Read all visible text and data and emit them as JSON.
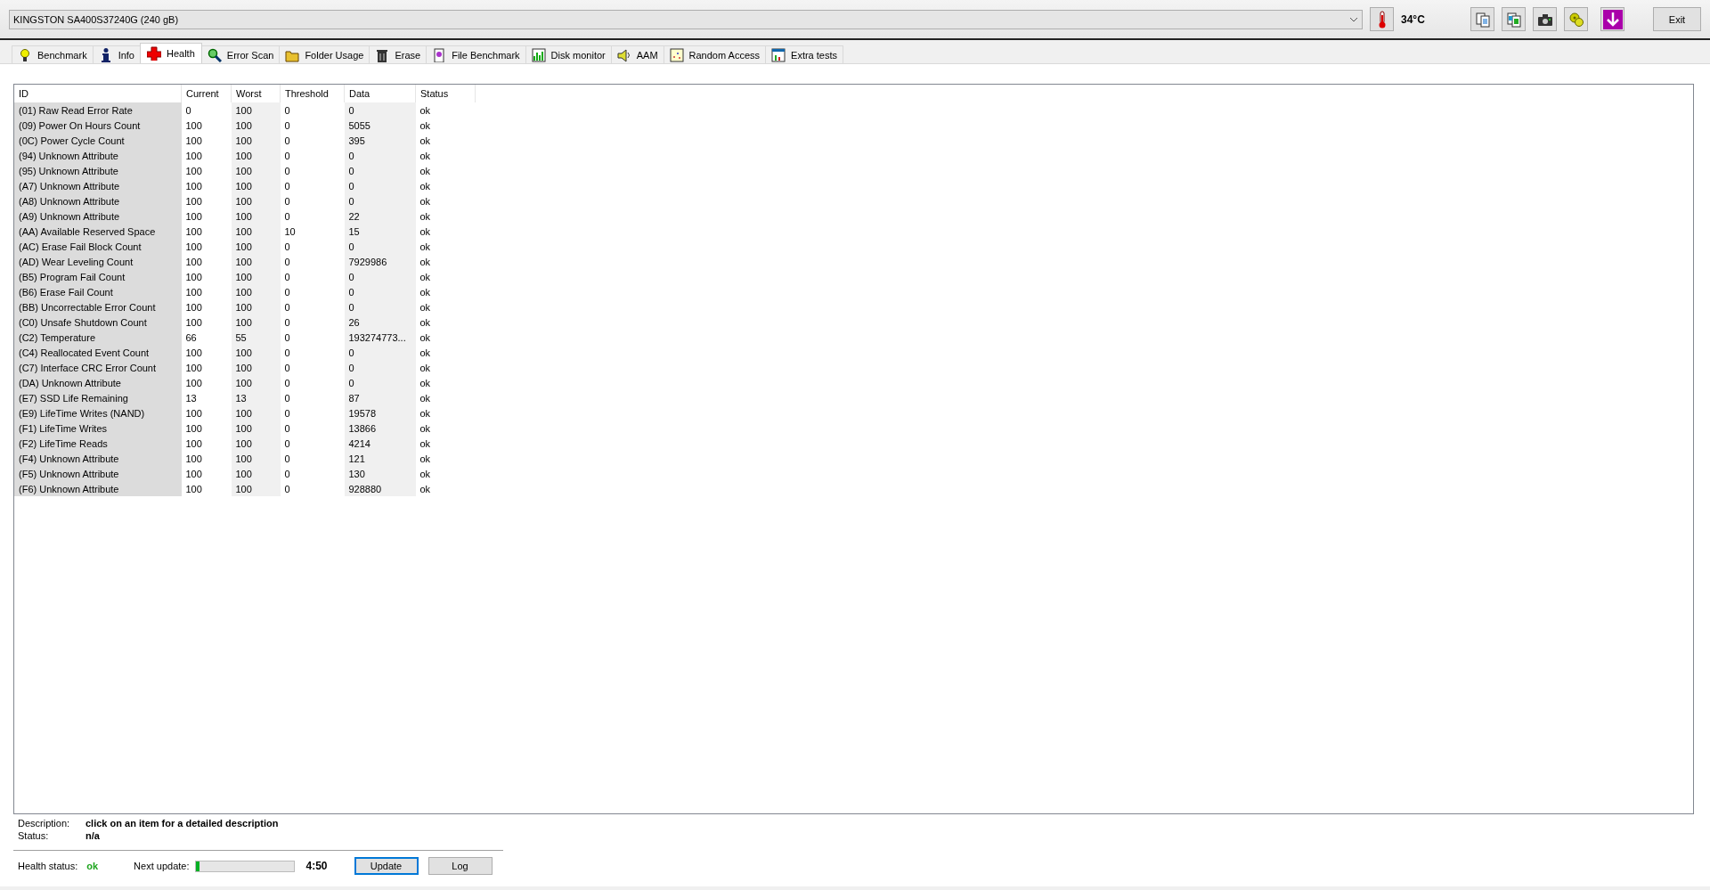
{
  "toolbar": {
    "drive": "KINGSTON SA400S37240G (240 gB)",
    "temperature": "34°C",
    "exit_button": "Exit"
  },
  "tabs": [
    {
      "label": "Benchmark",
      "selected": false
    },
    {
      "label": "Info",
      "selected": false
    },
    {
      "label": "Health",
      "selected": true
    },
    {
      "label": "Error Scan",
      "selected": false
    },
    {
      "label": "Folder Usage",
      "selected": false
    },
    {
      "label": "Erase",
      "selected": false
    },
    {
      "label": "File Benchmark",
      "selected": false
    },
    {
      "label": "Disk monitor",
      "selected": false
    },
    {
      "label": "AAM",
      "selected": false
    },
    {
      "label": "Random Access",
      "selected": false
    },
    {
      "label": "Extra tests",
      "selected": false
    }
  ],
  "table": {
    "columns": [
      "ID",
      "Current",
      "Worst",
      "Threshold",
      "Data",
      "Status"
    ],
    "rows": [
      [
        "(01) Raw Read Error Rate",
        "0",
        "100",
        "0",
        "0",
        "ok"
      ],
      [
        "(09) Power On Hours Count",
        "100",
        "100",
        "0",
        "5055",
        "ok"
      ],
      [
        "(0C) Power Cycle Count",
        "100",
        "100",
        "0",
        "395",
        "ok"
      ],
      [
        "(94) Unknown Attribute",
        "100",
        "100",
        "0",
        "0",
        "ok"
      ],
      [
        "(95) Unknown Attribute",
        "100",
        "100",
        "0",
        "0",
        "ok"
      ],
      [
        "(A7) Unknown Attribute",
        "100",
        "100",
        "0",
        "0",
        "ok"
      ],
      [
        "(A8) Unknown Attribute",
        "100",
        "100",
        "0",
        "0",
        "ok"
      ],
      [
        "(A9) Unknown Attribute",
        "100",
        "100",
        "0",
        "22",
        "ok"
      ],
      [
        "(AA) Available Reserved Space",
        "100",
        "100",
        "10",
        "15",
        "ok"
      ],
      [
        "(AC) Erase Fail Block Count",
        "100",
        "100",
        "0",
        "0",
        "ok"
      ],
      [
        "(AD) Wear Leveling Count",
        "100",
        "100",
        "0",
        "7929986",
        "ok"
      ],
      [
        "(B5) Program Fail Count",
        "100",
        "100",
        "0",
        "0",
        "ok"
      ],
      [
        "(B6) Erase Fail Count",
        "100",
        "100",
        "0",
        "0",
        "ok"
      ],
      [
        "(BB) Uncorrectable Error Count",
        "100",
        "100",
        "0",
        "0",
        "ok"
      ],
      [
        "(C0) Unsafe Shutdown Count",
        "100",
        "100",
        "0",
        "26",
        "ok"
      ],
      [
        "(C2) Temperature",
        "66",
        "55",
        "0",
        "193274773...",
        "ok"
      ],
      [
        "(C4) Reallocated Event Count",
        "100",
        "100",
        "0",
        "0",
        "ok"
      ],
      [
        "(C7) Interface CRC Error Count",
        "100",
        "100",
        "0",
        "0",
        "ok"
      ],
      [
        "(DA) Unknown Attribute",
        "100",
        "100",
        "0",
        "0",
        "ok"
      ],
      [
        "(E7) SSD Life Remaining",
        "13",
        "13",
        "0",
        "87",
        "ok"
      ],
      [
        "(E9) LifeTime Writes (NAND)",
        "100",
        "100",
        "0",
        "19578",
        "ok"
      ],
      [
        "(F1) LifeTime Writes",
        "100",
        "100",
        "0",
        "13866",
        "ok"
      ],
      [
        "(F2) LifeTime Reads",
        "100",
        "100",
        "0",
        "4214",
        "ok"
      ],
      [
        "(F4) Unknown Attribute",
        "100",
        "100",
        "0",
        "121",
        "ok"
      ],
      [
        "(F5) Unknown Attribute",
        "100",
        "100",
        "0",
        "130",
        "ok"
      ],
      [
        "(F6) Unknown Attribute",
        "100",
        "100",
        "0",
        "928880",
        "ok"
      ]
    ]
  },
  "details": {
    "description_label": "Description:",
    "description": "click on an item for a detailed description",
    "status_label": "Status:",
    "status": "n/a"
  },
  "footer": {
    "health_label": "Health status:",
    "health": "ok",
    "next_update_label": "Next update:",
    "next_update": {
      "level": 0.03,
      "time": "4:50"
    },
    "buttons": [
      "Update",
      "Log"
    ]
  }
}
